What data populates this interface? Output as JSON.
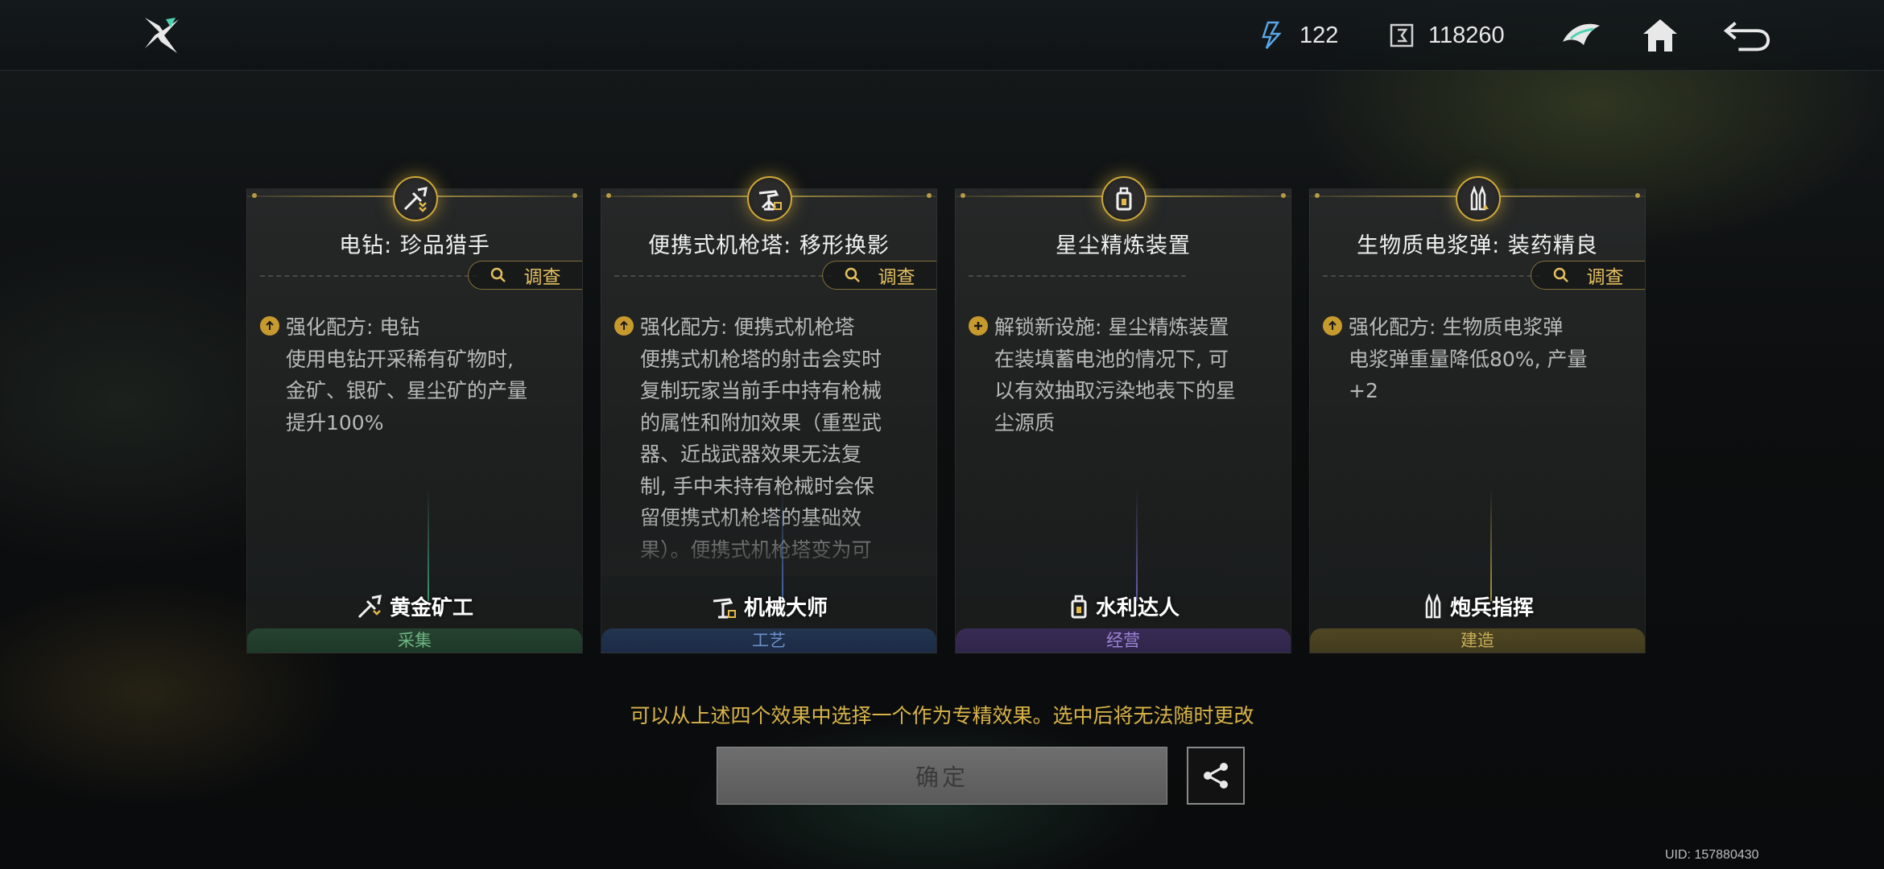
{
  "topbar": {
    "energy": "122",
    "coins": "118260",
    "icons": [
      "game-logo-icon",
      "energy-icon",
      "coin-icon",
      "ship-icon",
      "home-icon",
      "back-icon"
    ]
  },
  "cards": [
    {
      "title": "电钻: 珍品猎手",
      "inspect_label": "调查",
      "desc": "强化配方: 电钻\n使用电钻开采稀有矿物时,\n金矿、银矿、星尘矿的产量\n提升100%",
      "role": "黄金矿工",
      "category": "采集",
      "icon": "drill-icon"
    },
    {
      "title": "便携式机枪塔: 移形换影",
      "inspect_label": "调查",
      "desc": "强化配方: 便携式机枪塔\n便携式机枪塔的射击会实时\n复制玩家当前手中持有枪械\n的属性和附加效果（重型武\n器、近战武器效果无法复\n制, 手中未持有枪械时会保\n留便携式机枪塔的基础效\n果）。便携式机枪塔变为可\n重复使用道具, 冷却时间",
      "role": "机械大师",
      "category": "工艺",
      "icon": "turret-icon"
    },
    {
      "title": "星尘精炼装置",
      "inspect_label": "",
      "desc": "解锁新设施: 星尘精炼装置\n在装填蓄电池的情况下, 可\n以有效抽取污染地表下的星\n尘源质",
      "role": "水利达人",
      "category": "经营",
      "icon": "refinery-icon"
    },
    {
      "title": "生物质电浆弹: 装药精良",
      "inspect_label": "调查",
      "desc": "强化配方: 生物质电浆弹\n电浆弹重量降低80%, 产量\n+2",
      "role": "炮兵指挥",
      "category": "建造",
      "icon": "ammo-icon"
    }
  ],
  "hint": "可以从上述四个效果中选择一个作为专精效果。选中后将无法随时更改",
  "confirm_label": "确定",
  "uid": "UID: 157880430",
  "colors": {
    "accent_gold": "#d8b448",
    "gather_green": "#6db483",
    "craft_blue": "#6d8fc8",
    "manage_purple": "#9a84d6",
    "build_gold": "#c8ad58"
  }
}
